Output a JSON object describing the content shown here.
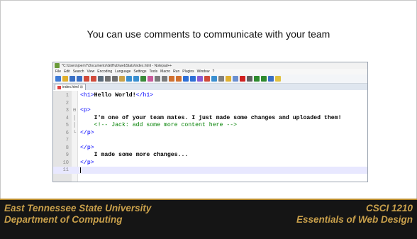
{
  "headline": "You can use comments to communicate with your team",
  "window": {
    "title": "*C:\\Users\\joem7\\Documents\\GitHub\\webStats\\index.html - Notepad++",
    "menus": [
      "File",
      "Edit",
      "Search",
      "View",
      "Encoding",
      "Language",
      "Settings",
      "Tools",
      "Macro",
      "Run",
      "Plugins",
      "Window",
      "?"
    ],
    "tab_label": "index.html",
    "tab_close": "⊠",
    "toolbar_icons": [
      "new-file-icon",
      "open-icon",
      "save-icon",
      "save-all-icon",
      "close-icon",
      "close-all-icon",
      "print-icon",
      "cut-icon",
      "copy-icon",
      "paste-icon",
      "undo-icon",
      "redo-icon",
      "find-icon",
      "replace-icon",
      "zoom-in-icon",
      "zoom-out-icon",
      "sync-v-icon",
      "sync-h-icon",
      "wrap-icon",
      "all-chars-icon",
      "indent-guide-icon",
      "user-lang-icon",
      "doc-map-icon",
      "func-list-icon",
      "folder-icon",
      "monitor-icon",
      "record-icon",
      "stop-icon",
      "play-icon",
      "play-multi-icon",
      "save-macro-icon",
      "spellcheck-icon"
    ],
    "toolbar_colors": [
      "#3e7bd6",
      "#e0b030",
      "#3a6fc4",
      "#3a6fc4",
      "#d04a3a",
      "#d04a3a",
      "#5a6a7a",
      "#707070",
      "#707070",
      "#c9a24a",
      "#3a8fd0",
      "#3a8fd0",
      "#3a8a3a",
      "#c85a9a",
      "#7a7a7a",
      "#7a7a7a",
      "#d07030",
      "#d07030",
      "#2e6fd6",
      "#2e6fd6",
      "#8a5ad0",
      "#d04a3a",
      "#3a8fd0",
      "#808080",
      "#e0b030",
      "#6a8fd0",
      "#d02020",
      "#606060",
      "#2e8a2e",
      "#2e8a2e",
      "#3a6fc4",
      "#e0c040"
    ]
  },
  "code": [
    {
      "ln": "1",
      "fold": "",
      "parts": [
        {
          "t": "<h1>",
          "c": "tag"
        },
        {
          "t": "Hello World!",
          "c": "bold"
        },
        {
          "t": "</h1>",
          "c": "tag"
        }
      ]
    },
    {
      "ln": "2",
      "fold": "",
      "parts": []
    },
    {
      "ln": "3",
      "fold": "⊟",
      "parts": [
        {
          "t": "<p>",
          "c": "tag"
        }
      ]
    },
    {
      "ln": "4",
      "fold": "│",
      "parts": [
        {
          "t": "    I'm one of your team mates. I just made some changes and uploaded them!",
          "c": "bold"
        }
      ]
    },
    {
      "ln": "5",
      "fold": "│",
      "parts": [
        {
          "t": "    <!-- Jack: add some more content here -->",
          "c": "comment"
        }
      ]
    },
    {
      "ln": "6",
      "fold": "└",
      "parts": [
        {
          "t": "</p>",
          "c": "tag"
        }
      ]
    },
    {
      "ln": "7",
      "fold": "",
      "parts": []
    },
    {
      "ln": "8",
      "fold": "",
      "parts": [
        {
          "t": "</p>",
          "c": "tag"
        }
      ]
    },
    {
      "ln": "9",
      "fold": "",
      "parts": [
        {
          "t": "    I made some more changes...",
          "c": "bold"
        }
      ]
    },
    {
      "ln": "10",
      "fold": "",
      "parts": [
        {
          "t": "</p>",
          "c": "tag"
        }
      ]
    },
    {
      "ln": "11",
      "fold": "",
      "parts": [],
      "current": true
    }
  ],
  "footer": {
    "left_line1": "East Tennessee State University",
    "left_line2": "Department of Computing",
    "right_line1": "CSCI 1210",
    "right_line2": "Essentials of Web Design"
  }
}
